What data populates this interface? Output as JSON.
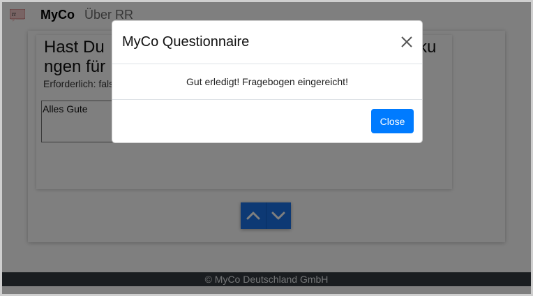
{
  "navbar": {
    "brand": "MyCo",
    "links": [
      "Über RR"
    ],
    "logo_icon": "rr-logo-icon"
  },
  "question": {
    "line1": "Hast Du",
    "line1_tail": "ku",
    "line2": "ngen für",
    "required_label": "Erforderlich: fals",
    "answer_value": "Alles Gute"
  },
  "navigation": {
    "up_icon": "chevron-up-icon",
    "down_icon": "chevron-down-icon",
    "button_color": "#1a73e8"
  },
  "footer": {
    "text": "© MyCo Deutschland GmbH"
  },
  "modal": {
    "title": "MyCo Questionnaire",
    "close_icon": "close-icon",
    "body": "Gut erledigt! Fragebogen eingereicht!",
    "close_button_label": "Close",
    "primary_color": "#007bff"
  }
}
